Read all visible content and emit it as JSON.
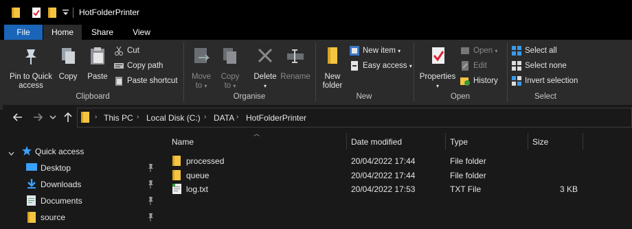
{
  "window": {
    "title": "HotFolderPrinter"
  },
  "ribbon_tabs": {
    "file": "File",
    "home": "Home",
    "share": "Share",
    "view": "View"
  },
  "clipboard": {
    "pin_line1": "Pin to Quick",
    "pin_line2": "access",
    "copy": "Copy",
    "paste": "Paste",
    "cut": "Cut",
    "copy_path": "Copy path",
    "paste_shortcut": "Paste shortcut",
    "group": "Clipboard"
  },
  "organise": {
    "move_to": "Move",
    "move_to2": "to",
    "copy_to": "Copy",
    "copy_to2": "to",
    "delete": "Delete",
    "rename": "Rename",
    "group": "Organise"
  },
  "new": {
    "new_folder1": "New",
    "new_folder2": "folder",
    "new_item": "New item",
    "easy_access": "Easy access",
    "group": "New"
  },
  "open": {
    "properties": "Properties",
    "open": "Open",
    "edit": "Edit",
    "history": "History",
    "group": "Open"
  },
  "select": {
    "select_all": "Select all",
    "select_none": "Select none",
    "invert": "Invert selection",
    "group": "Select"
  },
  "address": {
    "crumbs": [
      "This PC",
      "Local Disk (C:)",
      "DATA",
      "HotFolderPrinter"
    ]
  },
  "navpane": {
    "quick_access": "Quick access",
    "items": [
      "Desktop",
      "Downloads",
      "Documents",
      "source"
    ]
  },
  "columns": {
    "name": "Name",
    "date": "Date modified",
    "type": "Type",
    "size": "Size"
  },
  "files": [
    {
      "name": "processed",
      "date": "20/04/2022 17:44",
      "type": "File folder",
      "size": ""
    },
    {
      "name": "queue",
      "date": "20/04/2022 17:44",
      "type": "File folder",
      "size": ""
    },
    {
      "name": "log.txt",
      "date": "20/04/2022 17:53",
      "type": "TXT File",
      "size": "3 KB"
    }
  ],
  "colors": {
    "file_tab": "#1a65b8",
    "folder": "#f5c542",
    "star": "#3aa0ff"
  }
}
